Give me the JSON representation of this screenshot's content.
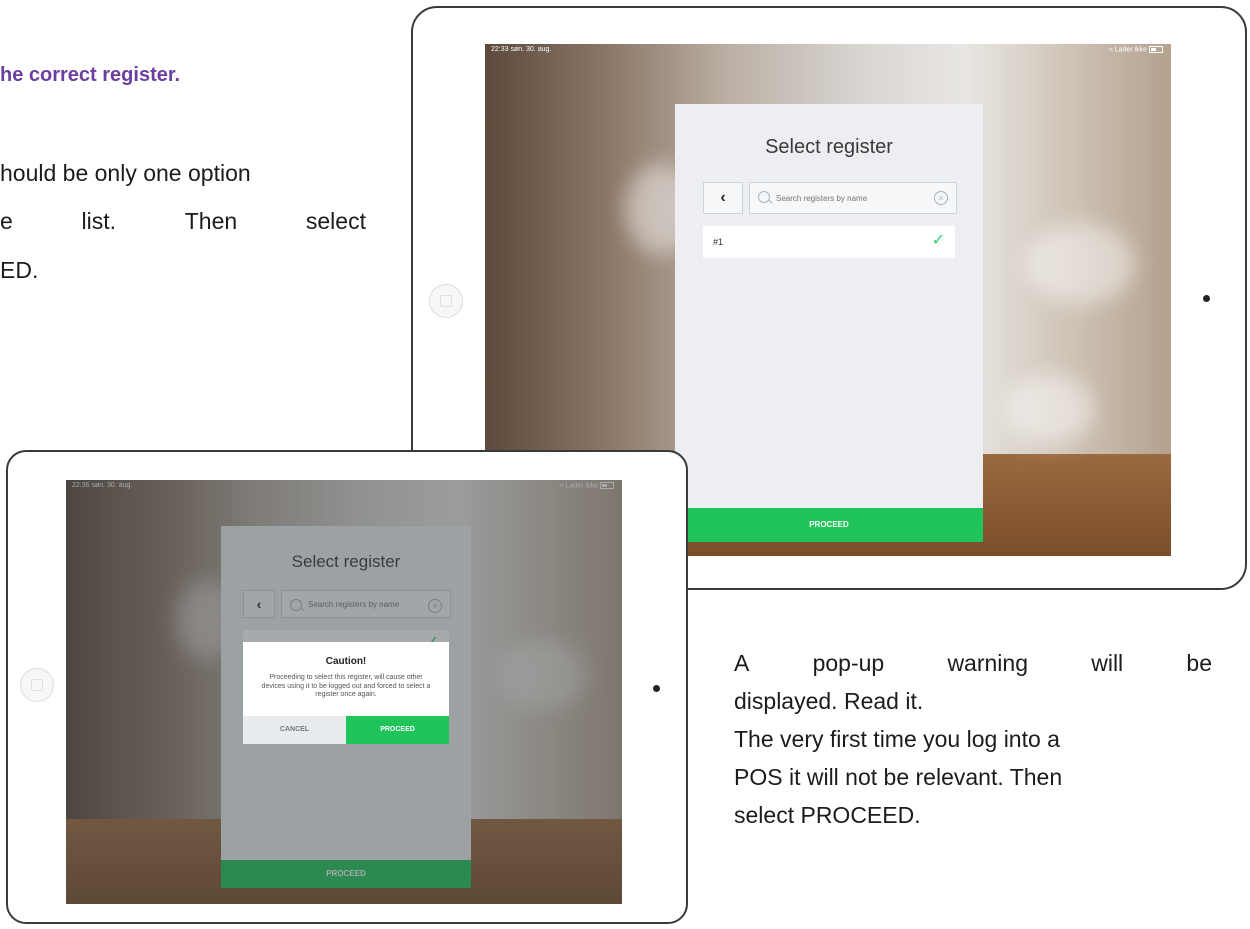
{
  "doc": {
    "heading": "he correct register.",
    "instr_line1": "hould be only one option",
    "instr_line2_words": [
      "e",
      "list.",
      "Then",
      "select"
    ],
    "instr_line3": "ED.",
    "caption_line1_words": [
      "A",
      "pop-up",
      "warning",
      "will",
      "be"
    ],
    "caption_line2": "displayed. Read it.",
    "caption_line3": "The very first time you log into a",
    "caption_line4": "POS it will not be relevant. Then",
    "caption_line5": "select PROCEED."
  },
  "top_screen": {
    "status_time": "22:33  søn. 30. aug.",
    "status_right": "Lader ikke",
    "title": "Select register",
    "search_placeholder": "Search registers by name",
    "register": "#1",
    "proceed": "PROCEED"
  },
  "bottom_screen": {
    "status_time": "22:36  søn. 30. aug.",
    "status_right": "Lader ikke",
    "title": "Select register",
    "search_placeholder": "Search registers by name",
    "proceed": "PROCEED",
    "modal": {
      "title": "Caution!",
      "body": "Proceeding to select this register, will cause other devices using it to be logged out and forced to select a register once again.",
      "cancel": "CANCEL",
      "proceed": "PROCEED"
    }
  }
}
